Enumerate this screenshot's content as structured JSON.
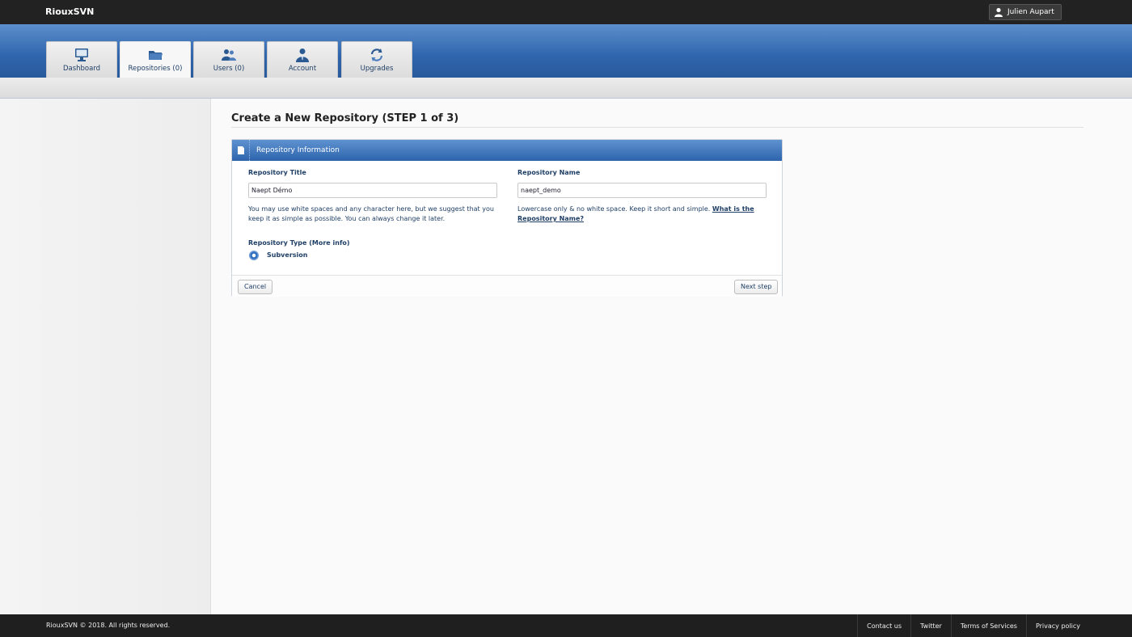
{
  "app": {
    "brand": "RiouxSVN"
  },
  "user": {
    "name": "Julien Aupart",
    "icon": "user-icon"
  },
  "tabs": [
    {
      "label": "Dashboard",
      "icon": "monitor-icon",
      "active": false
    },
    {
      "label": "Repositories (0)",
      "icon": "folder-icon",
      "active": true
    },
    {
      "label": "Users (0)",
      "icon": "users-icon",
      "active": false
    },
    {
      "label": "Account",
      "icon": "account-icon",
      "active": false
    },
    {
      "label": "Upgrades",
      "icon": "refresh-icon",
      "active": false
    }
  ],
  "page": {
    "title": "Create a New Repository (STEP 1 of 3)"
  },
  "panel": {
    "header": "Repository Information",
    "repo_title_label": "Repository Title",
    "repo_title_value": "Naept Démo",
    "repo_title_help": "You may use white spaces and any character here, but we suggest that you keep it as simple as possible. You can always change it later.",
    "repo_name_label": "Repository Name",
    "repo_name_value": "naept_demo",
    "repo_name_help": "Lowercase only & no white space. Keep it short and simple.",
    "repo_name_help_link": "What is the Repository Name?",
    "repo_type_label": "Repository Type (More info)",
    "repo_type_option": "Subversion"
  },
  "buttons": {
    "cancel": "Cancel",
    "next": "Next step"
  },
  "footer": {
    "copyright": "RiouxSVN © 2018. All rights reserved.",
    "links": [
      "Contact us",
      "Twitter",
      "Terms of Services",
      "Privacy policy"
    ]
  },
  "colors": {
    "accent": "#2f65ad",
    "topbar": "#222222",
    "text_link": "#1f3f66"
  }
}
